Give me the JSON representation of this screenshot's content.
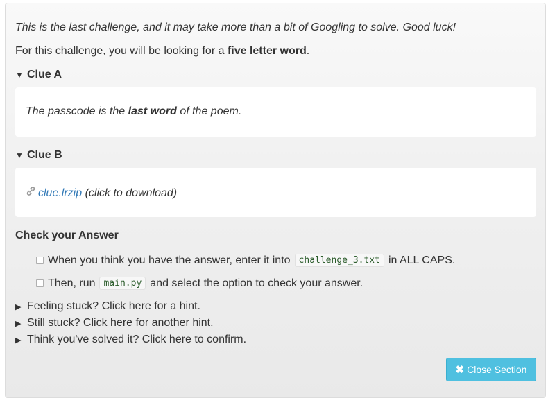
{
  "intro": "This is the last challenge, and it may take more than a bit of Googling to solve. Good luck!",
  "task": {
    "prefix": "For this challenge, you will be looking for a ",
    "bold": "five letter word",
    "suffix": "."
  },
  "clue_a": {
    "label": "Clue A",
    "pre": "The passcode is the ",
    "bold": "last word",
    "post": " of the poem."
  },
  "clue_b": {
    "label": "Clue B",
    "link_text": "clue.lrzip",
    "post": " (click to download)"
  },
  "check": {
    "title": "Check your Answer",
    "step1_pre": "When you think you have the answer, enter it into",
    "step1_code": "challenge_3.txt",
    "step1_post": "in ALL CAPS.",
    "step2_pre": "Then, run",
    "step2_code": "main.py",
    "step2_post": "and select the option to check your answer."
  },
  "hints": [
    "Feeling stuck? Click here for a hint.",
    "Still stuck? Click here for another hint.",
    "Think you've solved it? Click here to confirm."
  ],
  "close_button": "Close Section",
  "icons": {
    "expanded": "triangle-down-icon",
    "collapsed": "triangle-right-icon",
    "link": "link-icon",
    "close": "close-x-icon"
  }
}
